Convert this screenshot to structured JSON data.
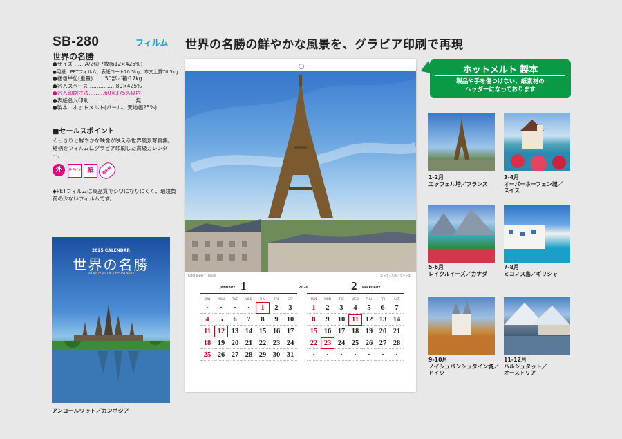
{
  "product": {
    "code": "SB-280",
    "type_label": "フィルム",
    "name": "世界の名勝"
  },
  "specs": [
    {
      "text": "●サイズ ……A/2切·7枚(612×425%)",
      "highlight": false
    },
    {
      "text": "●用紙…PETフィルム、表紙コート70.5kg、本文上質70.5kg",
      "highlight": false
    },
    {
      "text": "●梱包単位(重量) ……50部／箱·17kg",
      "highlight": false
    },
    {
      "text": "●名入スペース ……………80×425%",
      "highlight": false
    },
    {
      "text": "●名入印刷寸法………60×375%以内",
      "highlight": true
    },
    {
      "text": "●表紙名入印刷………………………無",
      "highlight": false
    },
    {
      "text": "●製本…ホットメルト(パール、天地幅25%)",
      "highlight": false
    }
  ],
  "sales_point": {
    "heading": "■セールスポイント",
    "body": "くっきりと鮮やかな映像が映える世界風景写真集。絵柄をフィルムにグラビア印刷した高級カレンダー。"
  },
  "icons": {
    "gai": "外",
    "mishin": "ミシン",
    "kami": "紙",
    "recycle": "再生紙"
  },
  "pet_note": "◆PETフィルムは高品質でシワになりにくく、環境負荷の少ないフィルムです。",
  "cover": {
    "top_text": "2025 CALENDAR",
    "title": "世界の名勝",
    "subtitle": "WONDERS OF THE WORLD",
    "caption": "アンコールワット／カンボジア"
  },
  "headline": "世界の名勝の鮮やかな風景を、グラビア印刷で再現",
  "sheet": {
    "photo_caption": "Eiffel Tower / France",
    "photo_caption_right": "エッフェル塔／フランス",
    "year": "2026",
    "weekdays": [
      "SUN",
      "MON",
      "TUE",
      "WED",
      "THU",
      "FRI",
      "SAT"
    ],
    "months": [
      {
        "number": "1",
        "name": "JANUARY",
        "weeks": [
          [
            "·",
            "·",
            "·",
            "·",
            "1",
            "2",
            "3"
          ],
          [
            "4",
            "5",
            "6",
            "7",
            "8",
            "9",
            "10"
          ],
          [
            "11",
            "12",
            "13",
            "14",
            "15",
            "16",
            "17"
          ],
          [
            "18",
            "19",
            "20",
            "21",
            "22",
            "23",
            "24"
          ],
          [
            "25",
            "26",
            "27",
            "28",
            "29",
            "30",
            "31"
          ]
        ]
      },
      {
        "number": "2",
        "name": "FEBRUARY",
        "weeks": [
          [
            "1",
            "2",
            "3",
            "4",
            "5",
            "6",
            "7"
          ],
          [
            "8",
            "9",
            "10",
            "11",
            "12",
            "13",
            "14"
          ],
          [
            "15",
            "16",
            "17",
            "18",
            "19",
            "20",
            "21"
          ],
          [
            "22",
            "23",
            "24",
            "25",
            "26",
            "27",
            "28"
          ],
          [
            "·",
            "·",
            "·",
            "·",
            "·",
            "·",
            "·"
          ]
        ]
      }
    ]
  },
  "callout": {
    "title": "ホットメルト 製本",
    "body_line1": "製品や手を傷つけない、紙素材の",
    "body_line2": "ヘッダーになっております"
  },
  "thumbnails": [
    {
      "months": "1-2月",
      "place": "エッフェル塔／フランス",
      "place2": ""
    },
    {
      "months": "3-4月",
      "place": "オーバーホーフェン城／",
      "place2": "スイス"
    },
    {
      "months": "5-6月",
      "place": "レイクルイーズ／カナダ",
      "place2": ""
    },
    {
      "months": "7-8月",
      "place": "ミコノス島／ギリシャ",
      "place2": ""
    },
    {
      "months": "9-10月",
      "place": "ノイシュバンシュタイン城／",
      "place2": "ドイツ"
    },
    {
      "months": "11-12月",
      "place": "ハルシュタット／",
      "place2": "オーストリア"
    }
  ],
  "colors": {
    "accent_green": "#0a9a45",
    "accent_pink": "#e6007e",
    "accent_blue": "#1a9fd9",
    "holiday_red": "#d7001a"
  }
}
